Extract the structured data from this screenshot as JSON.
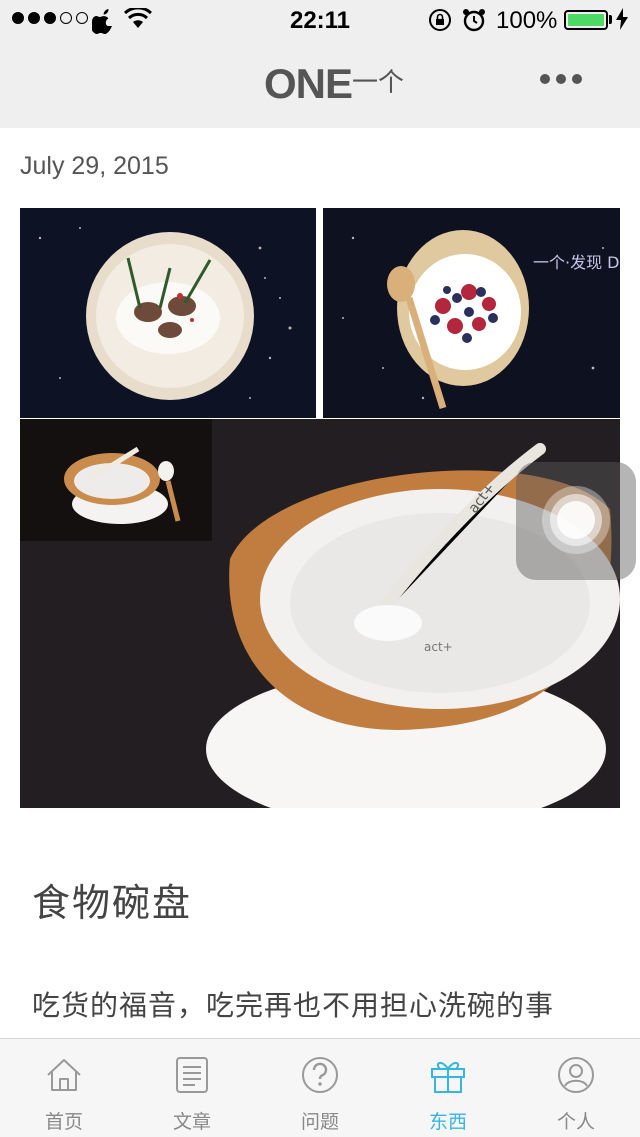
{
  "status_bar": {
    "time": "22:11",
    "battery_percent": "100%",
    "signal_bars": 3,
    "signal_total": 5,
    "battery_level": 1.0,
    "battery_color": "#4cd964"
  },
  "navbar": {
    "logo_text": "ONE",
    "logo_cn": "一个"
  },
  "content": {
    "date": "July 29, 2015",
    "images": [
      {
        "name": "food-plate-photo"
      },
      {
        "name": "yogurt-berries-photo",
        "watermark": "一个·发现 DISCOVER"
      },
      {
        "name": "bowl-spoon-photo",
        "spoon_text": "act+"
      }
    ],
    "title": "食物碗盘",
    "description": "吃货的福音，吃完再也不用担心洗碗的事"
  },
  "tabbar": {
    "active_color": "#36b6e6",
    "tabs": [
      {
        "label": "首页",
        "icon": "home-icon"
      },
      {
        "label": "文章",
        "icon": "article-icon"
      },
      {
        "label": "问题",
        "icon": "question-icon"
      },
      {
        "label": "东西",
        "icon": "gift-icon",
        "active": true
      },
      {
        "label": "个人",
        "icon": "person-icon"
      }
    ]
  }
}
